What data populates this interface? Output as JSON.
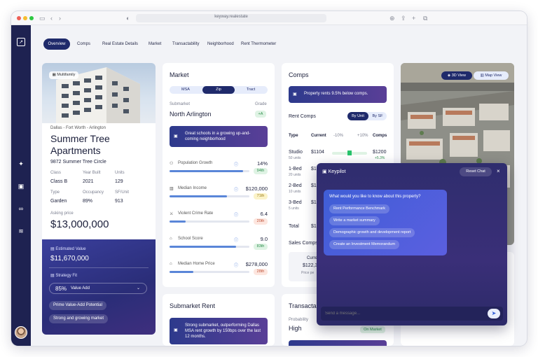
{
  "browser": {
    "url": "keyway.realestate"
  },
  "tabs": [
    "Overview",
    "Comps",
    "Real Estate Details",
    "Market",
    "Transactability",
    "Neighborhood",
    "Rent Thermometer"
  ],
  "property": {
    "badge": "Multifamily",
    "location": "Dallas - Fort Worth - Arlington",
    "name_line1": "Summer Tree",
    "name_line2": "Apartments",
    "address": "9872 Summer Tree Circle",
    "facts": [
      {
        "label": "Class",
        "value": "Class B"
      },
      {
        "label": "Year Built",
        "value": "2021"
      },
      {
        "label": "Units",
        "value": "129"
      },
      {
        "label": "Type",
        "value": "Garden"
      },
      {
        "label": "Occupancy",
        "value": "89%"
      },
      {
        "label": "SF/Unit",
        "value": "913"
      }
    ],
    "asking_label": "Asking price",
    "asking_price": "$13,000,000",
    "estimated_label": "Estimated Value",
    "estimated_value": "$11,670,000",
    "strategy_label": "Strategy Fit",
    "strategy_pct": "85%",
    "strategy_value": "Value Add",
    "chips": [
      "Prime Value-Add Potential",
      "Strong and growing market"
    ]
  },
  "market": {
    "title": "Market",
    "segments": [
      "MSA",
      "Zip",
      "Tract"
    ],
    "submarket_label": "Submarket",
    "grade_label": "Grade",
    "submarket": "North Arlington",
    "grade": "+A",
    "banner": "Great schools in a growing up-and-coming neighborhood",
    "metrics": [
      {
        "label": "Population Growth",
        "value": "14%",
        "badge": "94th",
        "fill": 0.92,
        "badge_color": "#dff3e4",
        "badge_text": "#2f8f4e"
      },
      {
        "label": "Median Income",
        "value": "$120,000",
        "badge": "71th",
        "fill": 0.72,
        "badge_color": "#fbf3c9",
        "badge_text": "#9a7a12"
      },
      {
        "label": "Violent Crime Rate",
        "value": "6.4",
        "badge": "20th",
        "fill": 0.2,
        "badge_color": "#fde6df",
        "badge_text": "#c0543a"
      },
      {
        "label": "School Score",
        "value": "9.0",
        "badge": "83th",
        "fill": 0.83,
        "badge_color": "#dff3e4",
        "badge_text": "#2f8f4e"
      },
      {
        "label": "Median Home Price",
        "value": "$278,000",
        "badge": "28th",
        "fill": 0.3,
        "badge_color": "#fde6df",
        "badge_text": "#c0543a"
      }
    ]
  },
  "submarket_rent": {
    "title": "Submarket Rent",
    "banner": "Strong submarket, outperforming Dallas MSA rent growth by 150bps over the last 12 months."
  },
  "comps": {
    "title": "Comps",
    "banner": "Property rents 9.5% below comps.",
    "rent_title": "Rent Comps",
    "toggle": [
      "By Unit",
      "By SF"
    ],
    "headers": [
      "Type",
      "Current",
      "-10%",
      "+10%",
      "Comps"
    ],
    "rows": [
      {
        "type": "Studio",
        "units": "50 units",
        "current": "$1104",
        "comps": "$1200",
        "delta": "+5.3%"
      },
      {
        "type": "1-Bed",
        "units": "20 units",
        "current": "$1"
      },
      {
        "type": "2-Bed",
        "units": "10 units",
        "current": "$1"
      },
      {
        "type": "3-Bed",
        "units": "5 units",
        "current": "$1"
      }
    ],
    "total_label": "Total",
    "total_value": "$1",
    "sales_title": "Sales Comps",
    "sales_current": "Curre",
    "sales_value": "$122,3",
    "sales_sub": "Price pe"
  },
  "transact": {
    "title": "Transacta",
    "prob_label": "Probability",
    "prob_value": "High",
    "badge": "On Market"
  },
  "map": {
    "view3d": "3D View",
    "mapview": "Map View"
  },
  "keypilot": {
    "title": "Keypilot",
    "reset": "Reset Chat",
    "question": "What would you like to know about this property?",
    "options": [
      "Rent Performance Benchmark",
      "Write a market summary",
      "Demographic growth and development report",
      "Create an Investment Memorandum"
    ],
    "placeholder": "Send a message..."
  }
}
